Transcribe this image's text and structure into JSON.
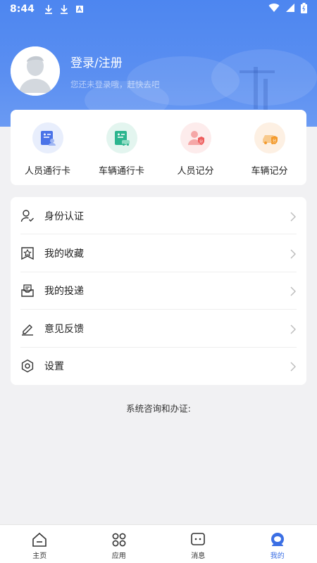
{
  "status_bar": {
    "time": "8:44"
  },
  "profile": {
    "title": "登录/注册",
    "subtitle": "您还未登录哦，赶快去吧"
  },
  "quick_actions": [
    {
      "label": "人员通行卡",
      "icon": "person-pass-card-icon",
      "color": "#4a73e8"
    },
    {
      "label": "车辆通行卡",
      "icon": "vehicle-pass-card-icon",
      "color": "#2cb58f"
    },
    {
      "label": "人员记分",
      "icon": "person-score-icon",
      "color": "#ee5d5d"
    },
    {
      "label": "车辆记分",
      "icon": "vehicle-score-icon",
      "color": "#f39a2d"
    }
  ],
  "menu": [
    {
      "label": "身份认证",
      "icon": "identity-verify-icon"
    },
    {
      "label": "我的收藏",
      "icon": "favorites-icon"
    },
    {
      "label": "我的投递",
      "icon": "delivery-icon"
    },
    {
      "label": "意见反馈",
      "icon": "feedback-icon"
    },
    {
      "label": "设置",
      "icon": "settings-icon"
    }
  ],
  "consult_text": "系统咨询和办证:",
  "tabs": [
    {
      "label": "主页",
      "icon": "home-icon",
      "active": false
    },
    {
      "label": "应用",
      "icon": "apps-icon",
      "active": false
    },
    {
      "label": "消息",
      "icon": "message-icon",
      "active": false
    },
    {
      "label": "我的",
      "icon": "profile-icon",
      "active": true
    }
  ],
  "colors": {
    "header": "#4d86f0",
    "accent": "#3b6fe4"
  }
}
